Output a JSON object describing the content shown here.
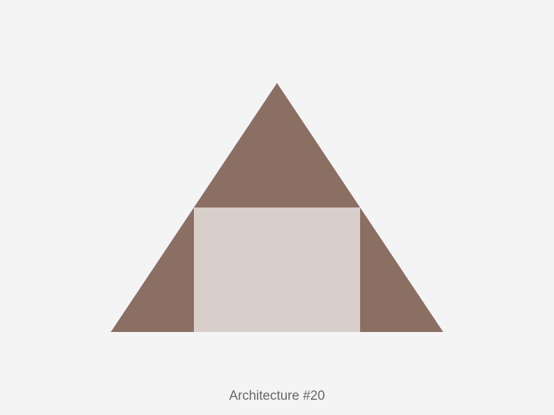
{
  "caption": "Architecture #20",
  "colors": {
    "background": "#f4f4f4",
    "roof": "#8b6f63",
    "wall": "#d8ceca",
    "caption": "#666666"
  }
}
